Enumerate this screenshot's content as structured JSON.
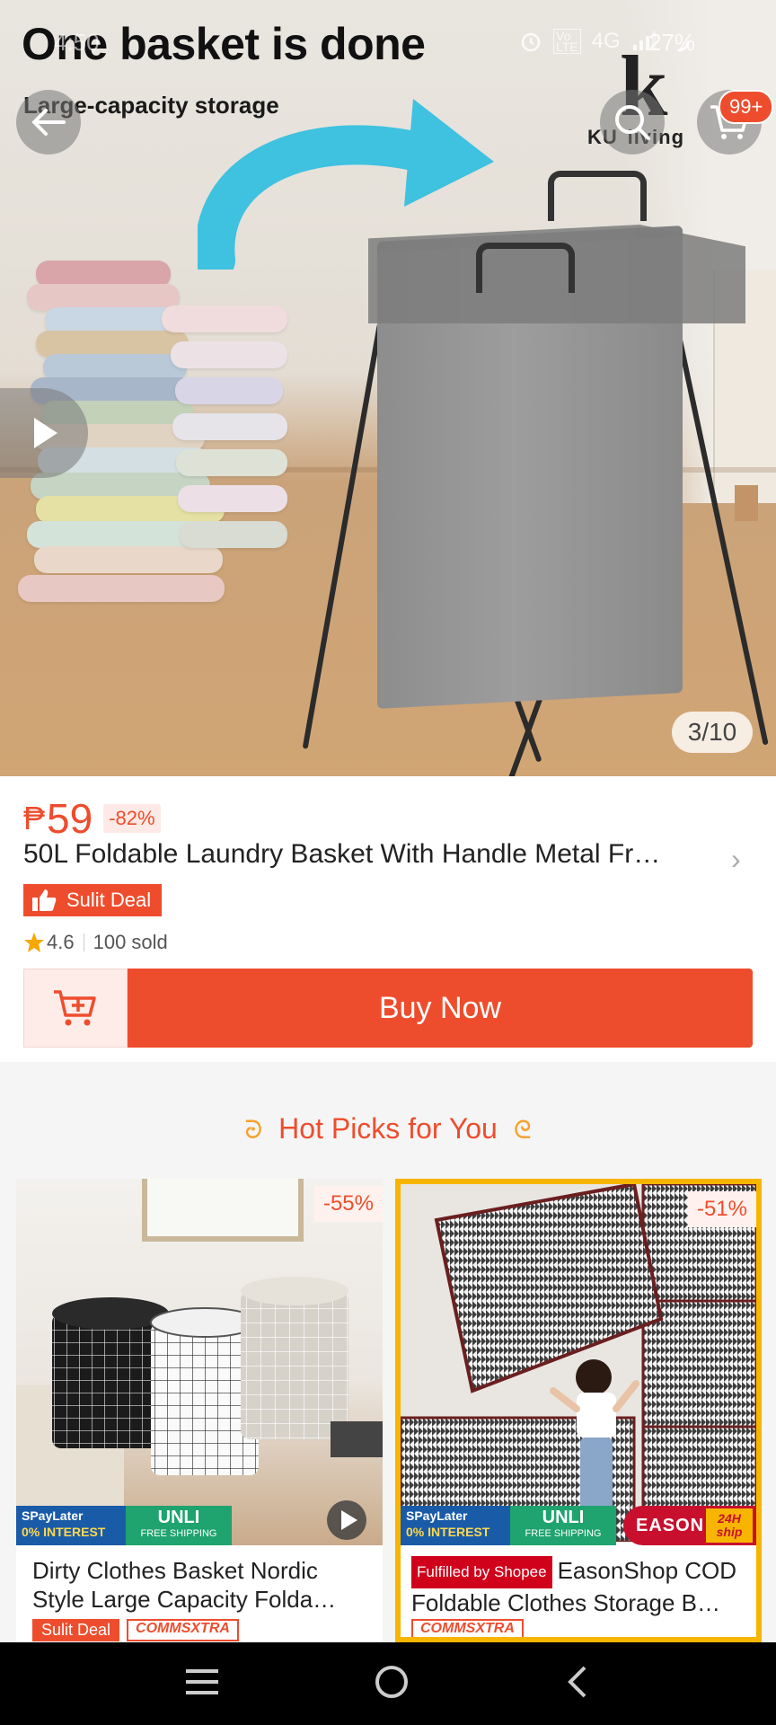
{
  "status_bar": {
    "time": "4:50",
    "icons": [
      "alarm-icon",
      "volte-icon",
      "4g-icon",
      "signal-icon"
    ],
    "network_label": "4G",
    "battery": "27%"
  },
  "hero": {
    "overlay_title": "One basket is done",
    "overlay_subtitle": "Large-capacity storage",
    "logo_letter": "k",
    "logo_text": "KU  living",
    "cart_badge": "99+",
    "page_indicator": "3/10"
  },
  "product": {
    "currency": "₱",
    "price": "59",
    "discount": "-82%",
    "title": "50L Foldable Laundry Basket With Handle Metal Fr…",
    "deal_label": "Sulit Deal",
    "rating": "4.6",
    "sold": "100 sold",
    "buy_label": "Buy Now"
  },
  "hot_picks": {
    "title": "Hot Picks for You",
    "items": [
      {
        "discount": "-55%",
        "promo_a_l1": "SPayLater",
        "promo_a_l2": "0% INTEREST",
        "promo_b_l1": "UNLI",
        "promo_b_l2": "FREE SHIPPING",
        "title": "Dirty Clothes Basket Nordic Style Large Capacity Folda…",
        "tag1": "Sulit Deal",
        "tag2": "COMMSXTRA"
      },
      {
        "discount": "-51%",
        "promo_a_l1": "SPayLater",
        "promo_a_l2": "0% INTEREST",
        "promo_b_l1": "UNLI",
        "promo_b_l2": "FREE SHIPPING",
        "fulfilled": "Fulfilled by Shopee",
        "title": "EasonShop COD Foldable Clothes Storage B…",
        "brand": "EASON",
        "ship_badge_l1": "24H",
        "ship_badge_l2": "ship",
        "tag2": "COMMSXTRA"
      }
    ]
  },
  "colors": {
    "accent": "#ee4d2d",
    "hot_deco": "#f7a12d"
  },
  "nav": [
    "menu-icon",
    "home-icon",
    "back-icon"
  ]
}
